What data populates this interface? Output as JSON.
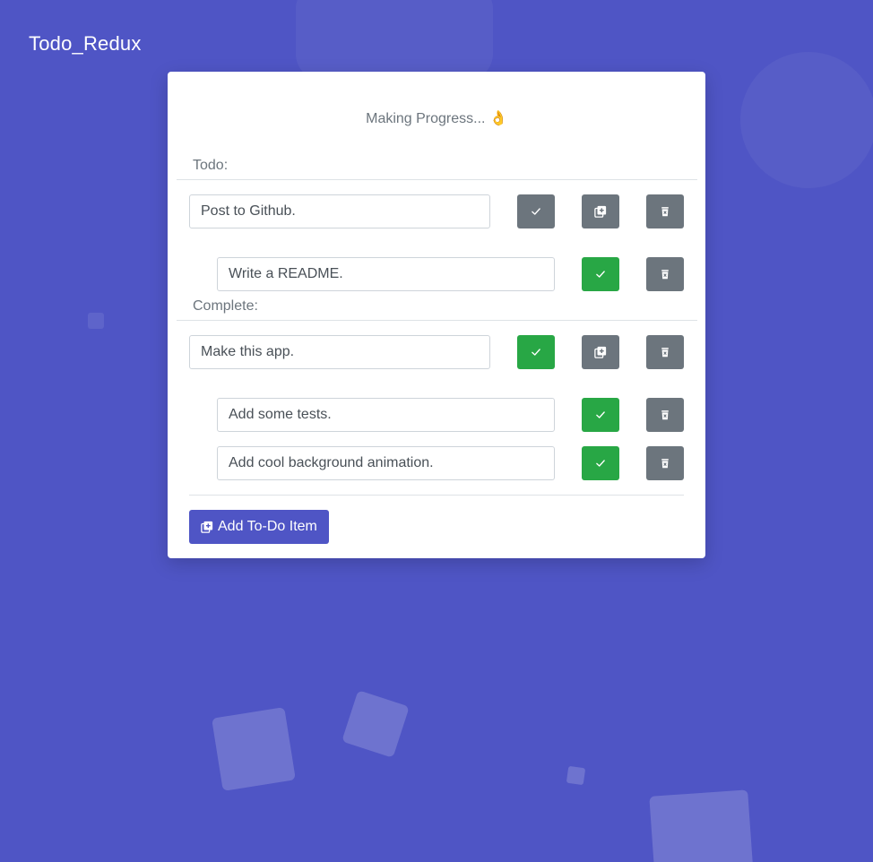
{
  "app": {
    "title": "Todo_Redux"
  },
  "card": {
    "progress_text": "Making Progress...",
    "progress_emoji": "👌"
  },
  "sections": {
    "todo_label": "Todo:",
    "complete_label": "Complete:"
  },
  "items": {
    "todo_parent": {
      "text": "Post to Github.",
      "done": false
    },
    "todo_child": {
      "text": "Write a README.",
      "done": true
    },
    "complete_parent": {
      "text": "Make this app.",
      "done": true
    },
    "complete_child_1": {
      "text": "Add some tests.",
      "done": true
    },
    "complete_child_2": {
      "text": "Add cool background animation.",
      "done": true
    }
  },
  "footer": {
    "add_button_label": "Add To-Do Item"
  },
  "icons": {
    "complete": "check-icon",
    "add_subitem": "add-copy-icon",
    "delete": "trash-icon"
  },
  "colors": {
    "background": "#4f55c5",
    "button_gray": "#6c757d",
    "button_green": "#28a745",
    "primary": "#4f55c5"
  }
}
